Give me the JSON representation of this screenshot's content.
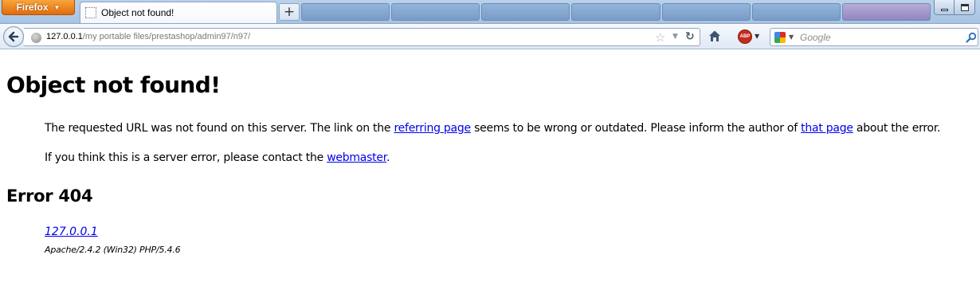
{
  "browser": {
    "menu_button_label": "Firefox",
    "active_tab": {
      "title": "Object not found!"
    },
    "new_tab_symbol": "+",
    "background_windows_count": "7",
    "address": {
      "host": "127.0.0.1",
      "path": "/my portable files/prestashop/admin97/n97/"
    },
    "search": {
      "engine": "Google",
      "placeholder": "Google"
    },
    "addon_badge": "ABP",
    "icons": {
      "back": "back-arrow-icon",
      "site": "globe-icon",
      "bookmark": "star-icon",
      "history": "dropdown-arrow-icon",
      "reload": "reload-icon",
      "home": "home-icon",
      "adblock": "adblock-plus-icon",
      "search_engine": "google-icon",
      "search_go": "magnifier-icon"
    }
  },
  "page": {
    "heading": "Object not found!",
    "paragraph1": {
      "text_before": "The requested URL was not found on this server. The link on the ",
      "link1": "referring page",
      "text_middle": " seems to be wrong or outdated. Please inform the author of ",
      "link2": "that page",
      "text_after": " about the error."
    },
    "paragraph2": {
      "text_before": "If you think this is a server error, please contact the ",
      "link": "webmaster",
      "text_after": "."
    },
    "error_heading": "Error 404",
    "address_link": "127.0.0.1",
    "server_signature": "Apache/2.4.2 (Win32) PHP/5.4.6",
    "colors": {
      "link": "#0000ee",
      "visited_link": "#551a8b",
      "firefox_button": "#e36c0a"
    }
  }
}
